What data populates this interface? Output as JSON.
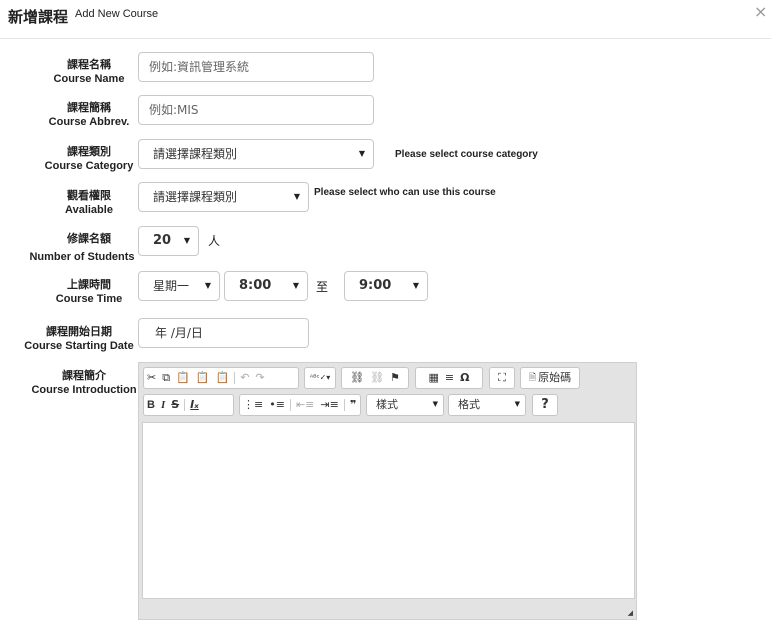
{
  "header": {
    "title_zh": "新增課程",
    "title_en": "Add New Course",
    "close": "×"
  },
  "fields": {
    "name": {
      "zh": "課程名稱",
      "en": "Course Name",
      "placeholder": "例如:資訊管理系統"
    },
    "abbrev": {
      "zh": "課程簡稱",
      "en": "Course Abbrev.",
      "placeholder": "例如:MIS"
    },
    "category": {
      "zh": "課程類別",
      "en": "Course Category",
      "selected": "請選擇課程類別",
      "hint": "Please select course category"
    },
    "available": {
      "zh": "觀看權限",
      "en": "Avaliable",
      "selected": "請選擇課程類別",
      "hint": "Please select who can use this course"
    },
    "students": {
      "zh": "修課名額",
      "en": "Number of Students",
      "selected": "20",
      "unit": "人"
    },
    "time": {
      "zh": "上課時間",
      "en": "Course Time",
      "day": "星期一",
      "start": "8:00",
      "sep": "至",
      "end": "9:00"
    },
    "start_date": {
      "zh": "課程開始日期",
      "en": "Course Starting Date",
      "value": "年 /月/日"
    },
    "intro": {
      "zh": "課程簡介",
      "en": "Course Introduction"
    }
  },
  "editor": {
    "row1": {
      "clipboard": [
        "✂",
        "⧉",
        "📋",
        "📋",
        "📋"
      ],
      "undo": [
        "↶",
        "↷"
      ],
      "spell": "ᴬᴮᶜ✓▾",
      "links": [
        "⛓",
        "⛓",
        "⚑"
      ],
      "insert": [
        "▦",
        "≡",
        "Ω"
      ],
      "maximize": "⛶",
      "source_icon": "🗎",
      "source_label": "原始碼"
    },
    "row2": {
      "basic": [
        "B",
        "I",
        "S",
        "Iₓ"
      ],
      "lists": [
        "⋮≡",
        "•≡",
        "⇤≡",
        "⇥≡",
        "❞"
      ],
      "styles": "樣式",
      "format": "格式",
      "help": "?"
    }
  }
}
